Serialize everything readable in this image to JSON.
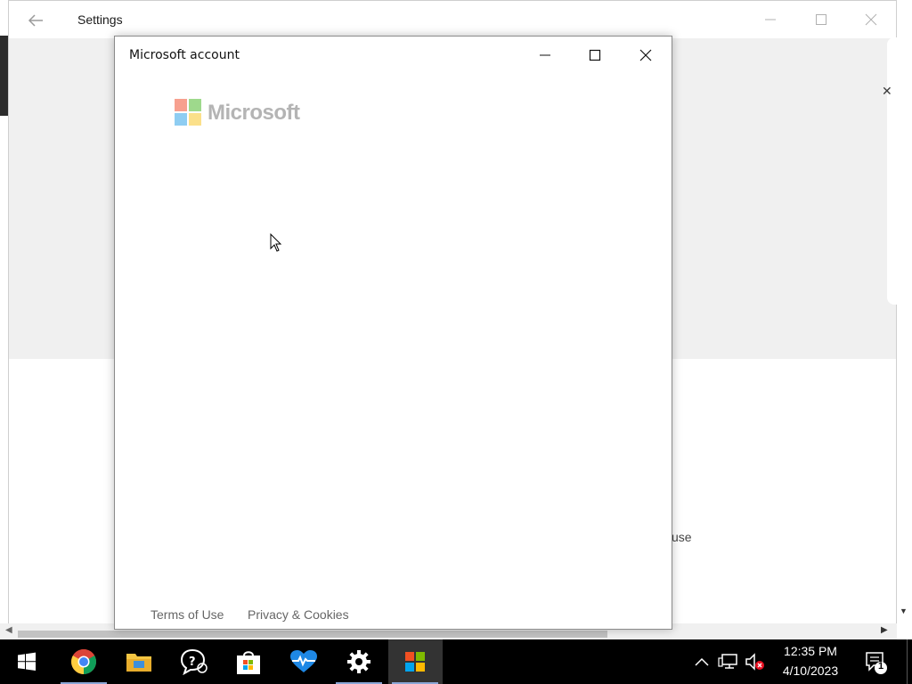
{
  "settings": {
    "title": "Settings",
    "partial_text": "use",
    "partial_x": "✕"
  },
  "dialog": {
    "title": "Microsoft account",
    "brand": {
      "wordmark": "Microsoft",
      "logo_colors": [
        "#f7a08f",
        "#9ed98c",
        "#8ecdf2",
        "#fbe08a"
      ]
    },
    "footer": {
      "terms": "Terms of Use",
      "privacy": "Privacy & Cookies"
    }
  },
  "taskbar": {
    "apps": [
      {
        "name": "start",
        "icon": "windows-logo-icon"
      },
      {
        "name": "chrome",
        "icon": "chrome-icon"
      },
      {
        "name": "file-explorer",
        "icon": "folder-icon"
      },
      {
        "name": "get-help",
        "icon": "help-chat-icon"
      },
      {
        "name": "store",
        "icon": "store-bag-icon"
      },
      {
        "name": "health",
        "icon": "heart-pulse-icon"
      },
      {
        "name": "settings",
        "icon": "gear-icon"
      },
      {
        "name": "microsoft-account",
        "icon": "microsoft-logo-icon"
      }
    ],
    "tray": {
      "time": "12:35 PM",
      "date": "4/10/2023",
      "notification_count": "1"
    }
  }
}
